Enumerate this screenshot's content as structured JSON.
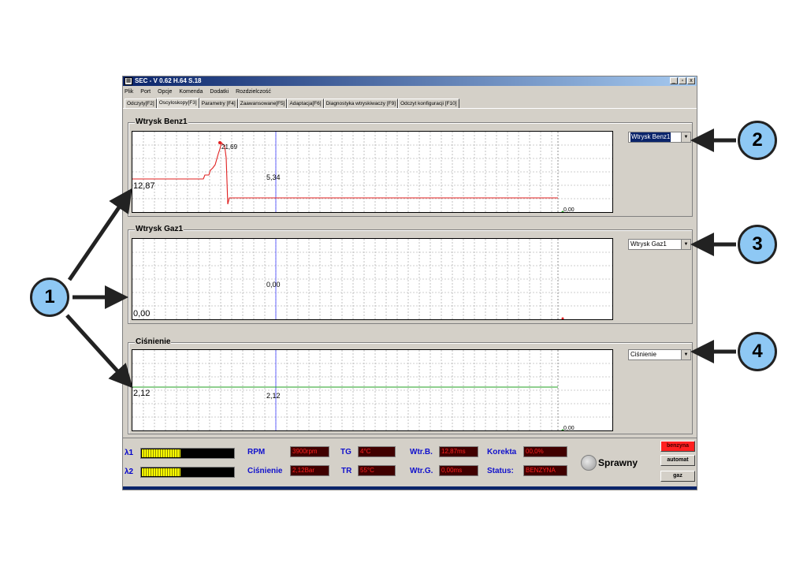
{
  "window": {
    "title": "SEC - V 0.62 H.64 S.18",
    "icon_name": "app-icon",
    "controls": [
      "_",
      "▫",
      "x"
    ]
  },
  "menu": [
    "Plik",
    "Port",
    "Opcje",
    "Komenda",
    "Dodatki",
    "Rozdzielczość"
  ],
  "tabs": [
    {
      "label": "Odczyty[F2]",
      "active": false
    },
    {
      "label": "Oscyloskopy[F3]",
      "active": true
    },
    {
      "label": "Parametry [F4]",
      "active": false
    },
    {
      "label": "Zaawansowane[F5]",
      "active": false
    },
    {
      "label": "Adaptacja[F6]",
      "active": false
    },
    {
      "label": "Diagnostyka wtryskiwaczy [F9]",
      "active": false
    },
    {
      "label": "Odczyt konfiguracji [F10]",
      "active": false
    }
  ],
  "scopes": [
    {
      "title": "Wtrysk Benz1",
      "select_value": "Wtrysk Benz1",
      "cursor_value": "5,34",
      "left_value": "12,87",
      "peak_label": "21,69",
      "end_value": "0,00",
      "trace_color": "#e02020"
    },
    {
      "title": "Wtrysk Gaz1",
      "select_value": "Wtrysk Gaz1",
      "cursor_value": "0,00",
      "left_value": "0,00",
      "peak_label": "",
      "end_value": "",
      "trace_color": "#e02020"
    },
    {
      "title": "Ciśnienie",
      "select_value": "Ciśnienie",
      "cursor_value": "2,12",
      "left_value": "2,12",
      "peak_label": "",
      "end_value": "0,00",
      "trace_color": "#20a020"
    }
  ],
  "status": {
    "lambda1_label": "λ1",
    "lambda2_label": "λ2",
    "lambda1_fill": 0.42,
    "lambda2_fill": 0.42,
    "rpm_label": "RPM",
    "rpm_value": "3900rpm",
    "cisnienie_label": "Ciśnienie",
    "cisnienie_value": "2,12Bar",
    "tg_label": "TG",
    "tg_value": "4°C",
    "tr_label": "TR",
    "tr_value": "55°C",
    "wtrb_label": "Wtr.B.",
    "wtrb_value": "12,87ms",
    "wtrg_label": "Wtr.G.",
    "wtrg_value": "0,00ms",
    "korekta_label": "Korekta",
    "korekta_value": "00,0%",
    "status_label": "Status:",
    "status_value": "BENZYNA",
    "sprawny_label": "Sprawny",
    "buttons": [
      "benzyna",
      "automat",
      "gaz"
    ]
  },
  "callouts": [
    "1",
    "2",
    "3",
    "4"
  ],
  "colors": {
    "callout_fill": "#8ec8f4",
    "title_bar": "#0a246a",
    "value_text": "#ff2020",
    "label_text": "#1010cc"
  }
}
